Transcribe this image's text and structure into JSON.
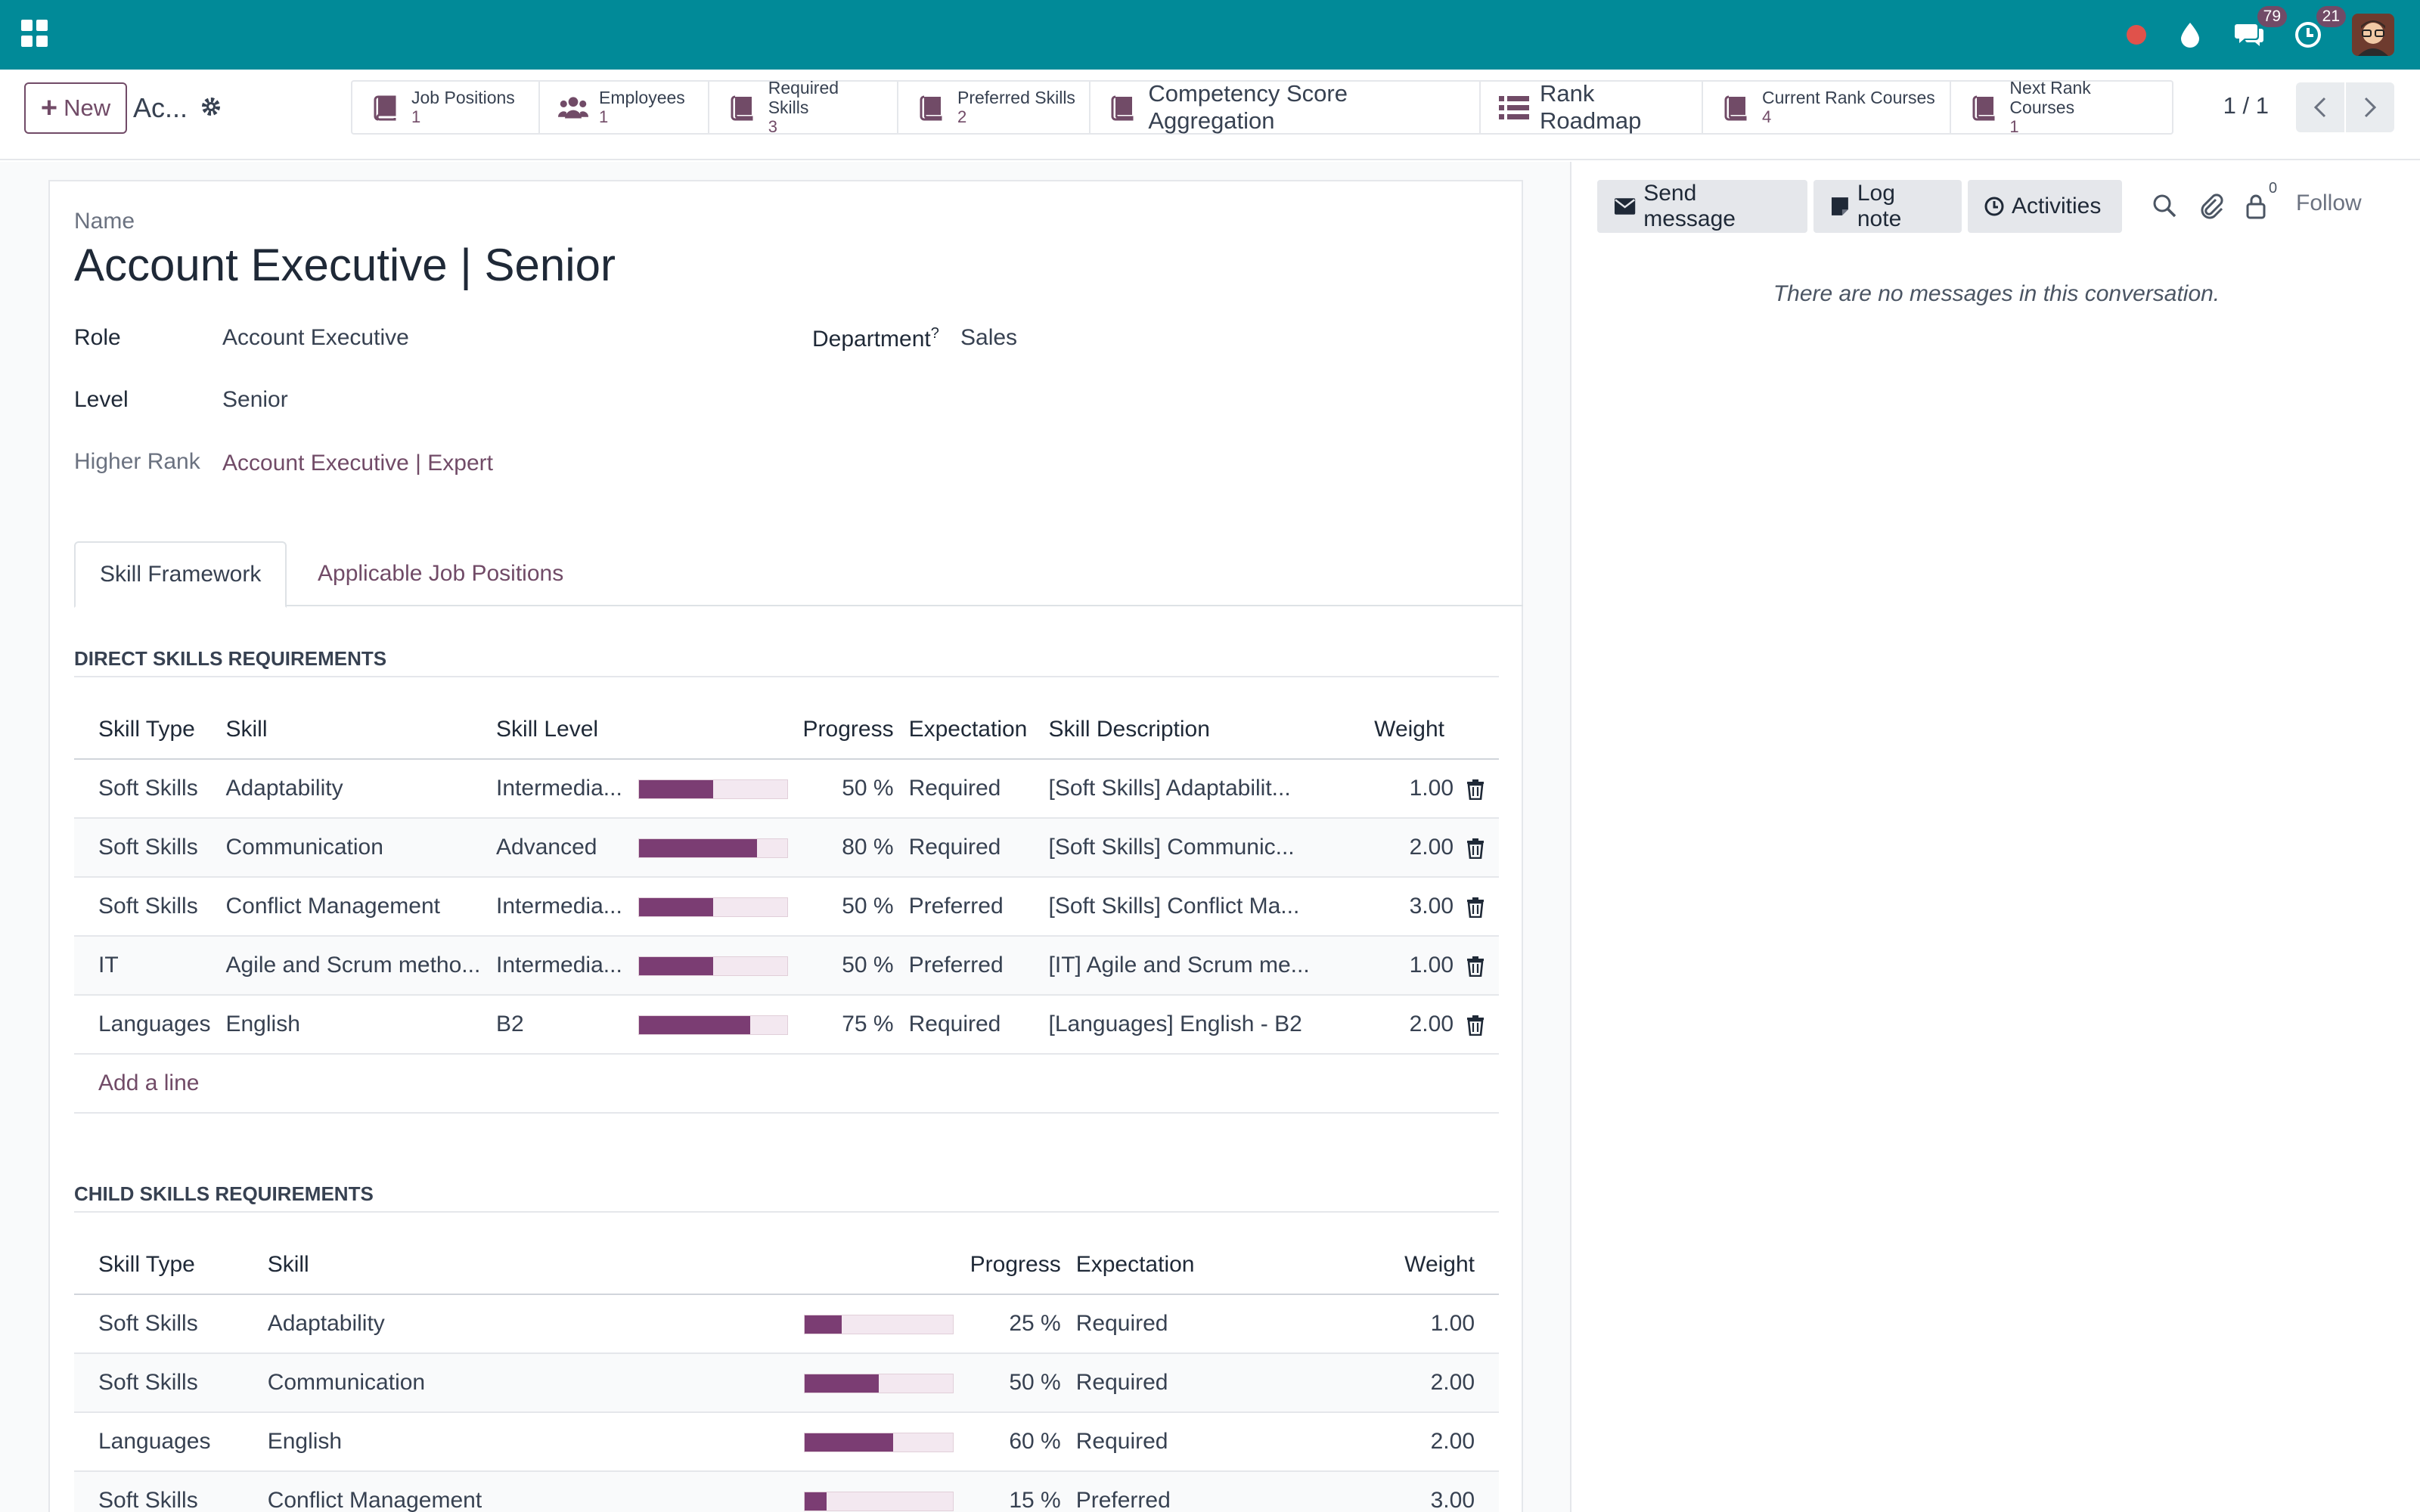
{
  "topbar": {
    "notifications": {
      "messages_count": "79",
      "activities_count": "21"
    }
  },
  "control": {
    "new_label": "New",
    "breadcrumb": "Ac...",
    "smart_buttons": [
      {
        "label": "Job Positions",
        "count": "1"
      },
      {
        "label": "Employees",
        "count": "1"
      },
      {
        "label": "Required Skills",
        "count": "3"
      },
      {
        "label": "Preferred Skills",
        "count": "2"
      },
      {
        "label": "Competency Score Aggregation"
      },
      {
        "label": "Rank Roadmap"
      },
      {
        "label": "Current Rank Courses",
        "count": "4"
      },
      {
        "label": "Next Rank Courses",
        "count": "1"
      }
    ],
    "pager": "1 / 1"
  },
  "form": {
    "name_label": "Name",
    "name_value": "Account Executive | Senior",
    "role_label": "Role",
    "role_value": "Account Executive",
    "department_label": "Department",
    "department_help": "?",
    "department_value": "Sales",
    "level_label": "Level",
    "level_value": "Senior",
    "higher_rank_label": "Higher Rank",
    "higher_rank_value": "Account Executive | Expert",
    "tabs": [
      "Skill Framework",
      "Applicable Job Positions"
    ]
  },
  "direct": {
    "title": "DIRECT SKILLS REQUIREMENTS",
    "headers": [
      "Skill Type",
      "Skill",
      "Skill Level",
      "Progress",
      "Expectation",
      "Skill Description",
      "Weight"
    ],
    "rows": [
      {
        "type": "Soft Skills",
        "skill": "Adaptability",
        "level": "Intermedia...",
        "progress": 50,
        "progress_label": "50 %",
        "expectation": "Required",
        "description": "[Soft Skills] Adaptabilit...",
        "weight": "1.00"
      },
      {
        "type": "Soft Skills",
        "skill": "Communication",
        "level": "Advanced",
        "progress": 80,
        "progress_label": "80 %",
        "expectation": "Required",
        "description": "[Soft Skills] Communic...",
        "weight": "2.00"
      },
      {
        "type": "Soft Skills",
        "skill": "Conflict Management",
        "level": "Intermedia...",
        "progress": 50,
        "progress_label": "50 %",
        "expectation": "Preferred",
        "description": "[Soft Skills] Conflict Ma...",
        "weight": "3.00"
      },
      {
        "type": "IT",
        "skill": "Agile and Scrum metho...",
        "level": "Intermedia...",
        "progress": 50,
        "progress_label": "50 %",
        "expectation": "Preferred",
        "description": "[IT] Agile and Scrum me...",
        "weight": "1.00"
      },
      {
        "type": "Languages",
        "skill": "English",
        "level": "B2",
        "progress": 75,
        "progress_label": "75 %",
        "expectation": "Required",
        "description": "[Languages] English - B2",
        "weight": "2.00"
      }
    ],
    "add_line": "Add a line"
  },
  "child": {
    "title": "CHILD SKILLS REQUIREMENTS",
    "headers": [
      "Skill Type",
      "Skill",
      "Progress",
      "Expectation",
      "Weight"
    ],
    "rows": [
      {
        "type": "Soft Skills",
        "skill": "Adaptability",
        "progress": 25,
        "progress_label": "25 %",
        "expectation": "Required",
        "weight": "1.00"
      },
      {
        "type": "Soft Skills",
        "skill": "Communication",
        "progress": 50,
        "progress_label": "50 %",
        "expectation": "Required",
        "weight": "2.00"
      },
      {
        "type": "Languages",
        "skill": "English",
        "progress": 60,
        "progress_label": "60 %",
        "expectation": "Required",
        "weight": "2.00"
      },
      {
        "type": "Soft Skills",
        "skill": "Conflict Management",
        "progress": 15,
        "progress_label": "15 %",
        "expectation": "Preferred",
        "weight": "3.00"
      }
    ]
  },
  "chatter": {
    "send_message": "Send message",
    "log_note": "Log note",
    "activities": "Activities",
    "followers_count": "0",
    "follow": "Follow",
    "empty": "There are no messages in this conversation."
  },
  "colors": {
    "navbar": "#018a98",
    "brand": "#714b67",
    "progress_fill": "#7b3d73"
  }
}
